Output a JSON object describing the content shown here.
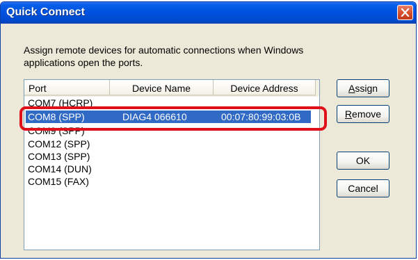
{
  "window": {
    "title": "Quick Connect"
  },
  "description": "Assign remote devices for automatic connections when Windows applications open the ports.",
  "list": {
    "columns": [
      "Port",
      "Device Name",
      "Device Address"
    ],
    "rows": [
      {
        "port": "COM7 (HCRP)",
        "device_name": "",
        "device_address": ""
      },
      {
        "port": "COM8 (SPP)",
        "device_name": "DIAG4 066610",
        "device_address": "00:07:80:99:03:0B"
      },
      {
        "port": "COM9 (SPP)",
        "device_name": "",
        "device_address": ""
      },
      {
        "port": "COM12 (SPP)",
        "device_name": "",
        "device_address": ""
      },
      {
        "port": "COM13 (SPP)",
        "device_name": "",
        "device_address": ""
      },
      {
        "port": "COM14 (DUN)",
        "device_name": "",
        "device_address": ""
      },
      {
        "port": "COM15 (FAX)",
        "device_name": "",
        "device_address": ""
      }
    ],
    "selected_row_index": 1
  },
  "buttons": {
    "assign": {
      "accel": "A",
      "rest": "ssign"
    },
    "remove": {
      "accel": "R",
      "rest": "emove"
    },
    "ok": "OK",
    "cancel": "Cancel"
  },
  "icons": {
    "close": "close-x-icon"
  },
  "colors": {
    "selection": "#316ac5",
    "annotation_ring": "#e0101a",
    "titlebar": "#0054e3"
  }
}
